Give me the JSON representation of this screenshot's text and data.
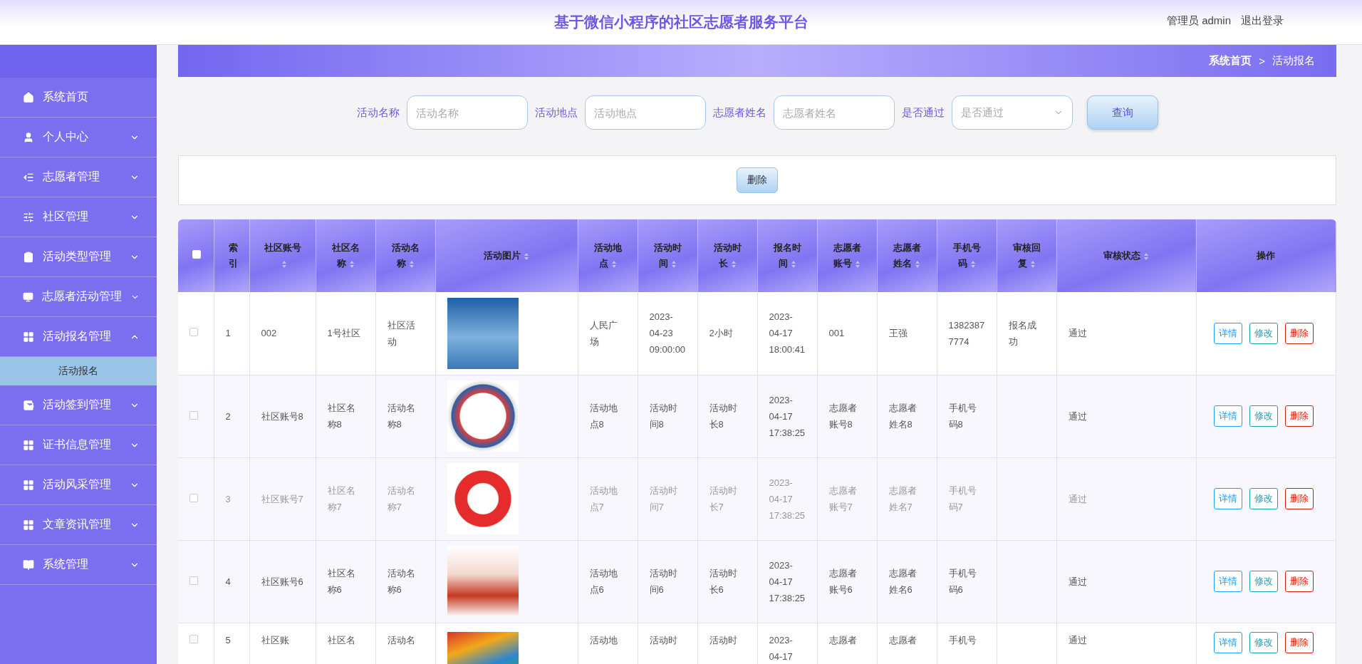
{
  "header": {
    "title": "基于微信小程序的社区志愿者服务平台",
    "user_label": "管理员 admin",
    "logout": "退出登录"
  },
  "sidebar": {
    "items": [
      {
        "label": "系统首页",
        "expandable": false,
        "expanded": false
      },
      {
        "label": "个人中心",
        "expandable": true,
        "expanded": false
      },
      {
        "label": "志愿者管理",
        "expandable": true,
        "expanded": false
      },
      {
        "label": "社区管理",
        "expandable": true,
        "expanded": false
      },
      {
        "label": "活动类型管理",
        "expandable": true,
        "expanded": false
      },
      {
        "label": "志愿者活动管理",
        "expandable": true,
        "expanded": false
      },
      {
        "label": "活动报名管理",
        "expandable": true,
        "expanded": true,
        "children": [
          {
            "label": "活动报名",
            "selected": true
          }
        ]
      },
      {
        "label": "活动签到管理",
        "expandable": true,
        "expanded": false
      },
      {
        "label": "证书信息管理",
        "expandable": true,
        "expanded": false
      },
      {
        "label": "活动风采管理",
        "expandable": true,
        "expanded": false
      },
      {
        "label": "文章资讯管理",
        "expandable": true,
        "expanded": false
      },
      {
        "label": "系统管理",
        "expandable": true,
        "expanded": false
      }
    ]
  },
  "breadcrumb": {
    "items": [
      {
        "label": "系统首页",
        "current": false
      },
      {
        "label": "活动报名",
        "current": true
      }
    ],
    "separator": ">"
  },
  "search": {
    "fields": [
      {
        "label": "活动名称",
        "placeholder": "活动名称",
        "kind": "input"
      },
      {
        "label": "活动地点",
        "placeholder": "活动地点",
        "kind": "input"
      },
      {
        "label": "志愿者姓名",
        "placeholder": "志愿者姓名",
        "kind": "input"
      },
      {
        "label": "是否通过",
        "placeholder": "是否通过",
        "kind": "select"
      }
    ],
    "button": "查询"
  },
  "toolbar": {
    "buttons": [
      "删除"
    ]
  },
  "table": {
    "header_checkbox": {
      "checked": false
    },
    "columns": [
      {
        "label": "索引",
        "sortable": false
      },
      {
        "label": "社区账号",
        "sortable": true
      },
      {
        "label": "社区名称",
        "sortable": true
      },
      {
        "label": "活动名称",
        "sortable": true
      },
      {
        "label": "活动图片",
        "sortable": true
      },
      {
        "label": "活动地点",
        "sortable": true
      },
      {
        "label": "活动时间",
        "sortable": true
      },
      {
        "label": "活动时长",
        "sortable": true
      },
      {
        "label": "报名时间",
        "sortable": true
      },
      {
        "label": "志愿者账号",
        "sortable": true
      },
      {
        "label": "志愿者姓名",
        "sortable": true
      },
      {
        "label": "手机号码",
        "sortable": true
      },
      {
        "label": "审核回复",
        "sortable": true
      },
      {
        "label": "审核状态",
        "sortable": true
      },
      {
        "label": "操作",
        "sortable": false
      }
    ],
    "rows": [
      {
        "checked": false,
        "highlighted": false,
        "cells": [
          "1",
          "002",
          "1号社区",
          "社区活动",
          null,
          "人民广场",
          "2023-04-23 09:00:00",
          "2小时",
          "2023-04-17 18:00:41",
          "001",
          "王强",
          "13823877774",
          "报名成功",
          "通过"
        ],
        "actions": [
          {
            "label": "详情",
            "kind": "detail"
          },
          {
            "label": "修改",
            "kind": "edit"
          },
          {
            "label": "删除",
            "kind": "delete"
          }
        ]
      },
      {
        "checked": false,
        "highlighted": false,
        "cells": [
          "2",
          "社区账号8",
          "社区名称8",
          "活动名称8",
          null,
          "活动地点8",
          "活动时间8",
          "活动时长8",
          "2023-04-17 17:38:25",
          "志愿者账号8",
          "志愿者姓名8",
          "手机号码8",
          null,
          "通过"
        ],
        "actions": [
          {
            "label": "详情",
            "kind": "detail"
          },
          {
            "label": "修改",
            "kind": "edit"
          },
          {
            "label": "删除",
            "kind": "delete"
          }
        ]
      },
      {
        "checked": false,
        "highlighted": true,
        "cells": [
          "3",
          "社区账号7",
          "社区名称7",
          "活动名称7",
          null,
          "活动地点7",
          "活动时间7",
          "活动时长7",
          "2023-04-17 17:38:25",
          "志愿者账号7",
          "志愿者姓名7",
          "手机号码7",
          null,
          "通过"
        ],
        "actions": [
          {
            "label": "详情",
            "kind": "detail"
          },
          {
            "label": "修改",
            "kind": "edit"
          },
          {
            "label": "删除",
            "kind": "delete"
          }
        ]
      },
      {
        "checked": false,
        "highlighted": false,
        "cells": [
          "4",
          "社区账号6",
          "社区名称6",
          "活动名称6",
          null,
          "活动地点6",
          "活动时间6",
          "活动时长6",
          "2023-04-17 17:38:25",
          "志愿者账号6",
          "志愿者姓名6",
          "手机号码6",
          null,
          "通过"
        ],
        "actions": [
          {
            "label": "详情",
            "kind": "detail"
          },
          {
            "label": "修改",
            "kind": "edit"
          },
          {
            "label": "删除",
            "kind": "delete"
          }
        ]
      },
      {
        "checked": false,
        "highlighted": false,
        "cells": [
          "5",
          "社区账",
          "社区名",
          "活动名",
          null,
          "活动地",
          "活动时",
          "活动时",
          "2023-04-17",
          "志愿者",
          "志愿者",
          "手机号",
          null,
          "通过"
        ],
        "actions": [
          {
            "label": "详情",
            "kind": "detail"
          },
          {
            "label": "修改",
            "kind": "edit"
          },
          {
            "label": "删除",
            "kind": "delete"
          }
        ]
      }
    ]
  }
}
